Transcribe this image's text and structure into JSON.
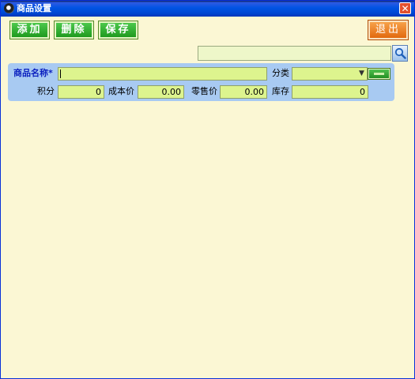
{
  "window": {
    "title": "商品设置",
    "close_glyph": "✕"
  },
  "toolbar": {
    "add_label": "添加",
    "delete_label": "删除",
    "save_label": "保存",
    "exit_label": "退出"
  },
  "search": {
    "value": "",
    "placeholder": ""
  },
  "form": {
    "name_label": "商品名称*",
    "name_value": "",
    "category_label": "分类",
    "category_value": "",
    "points_label": "积分",
    "points_value": "0",
    "cost_label": "成本价",
    "cost_value": "0.00",
    "retail_label": "零售价",
    "retail_value": "0.00",
    "stock_label": "库存",
    "stock_value": "0"
  },
  "icons": {
    "search": "magnifier-icon",
    "app": "app-icon",
    "close": "close-icon"
  },
  "colors": {
    "accent_green": "#1F9A1F",
    "exit_orange": "#E2690F",
    "panel_blue": "#A8CAF2",
    "field_green": "#DDF48E",
    "background": "#FBF7D4"
  }
}
